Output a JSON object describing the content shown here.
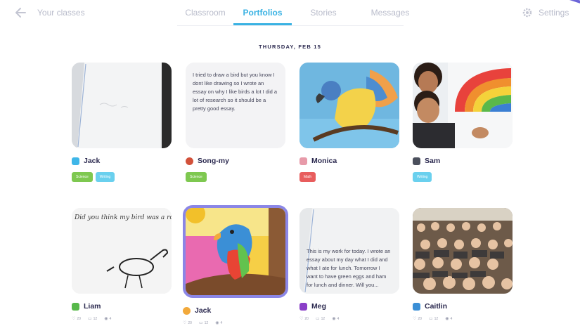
{
  "nav": {
    "back_label": "Your classes",
    "tabs": [
      {
        "label": "Classroom",
        "active": false
      },
      {
        "label": "Portfolios",
        "active": true
      },
      {
        "label": "Stories",
        "active": false
      },
      {
        "label": "Messages",
        "active": false
      }
    ],
    "settings_label": "Settings",
    "accent_color": "#3ab2e3"
  },
  "date_heading": "THURSDAY, FEB 15",
  "posts": [
    {
      "student": "Jack",
      "avatar_color": "#3fb6e8",
      "media": "photo-of-paper",
      "tags": [
        {
          "label": "Science",
          "color": "#7ec850"
        },
        {
          "label": "Writing",
          "color": "#6ad0ee"
        }
      ],
      "selected": false
    },
    {
      "student": "Song-my",
      "avatar_color": "#d2513a",
      "media": "text-note",
      "text": "I tried to draw a bird but you know I dont like drawing so I wrote an essay on why I like birds a lot I did a lot of research so it should be a pretty good essay.",
      "tags": [
        {
          "label": "Science",
          "color": "#7ec850"
        }
      ],
      "selected": false
    },
    {
      "student": "Monica",
      "avatar_color": "#e79aa9",
      "media": "painting-parrot",
      "tags": [
        {
          "label": "Math",
          "color": "#e85d5d"
        }
      ],
      "selected": false
    },
    {
      "student": "Sam",
      "avatar_color": "#4b4f5c",
      "media": "photo-rainbow",
      "tags": [
        {
          "label": "Writing",
          "color": "#6ad0ee"
        }
      ],
      "selected": false
    },
    {
      "student": "Liam",
      "avatar_color": "#57b84a",
      "media": "drawing-bird",
      "handwriting": "Did you think my bird was a robin or parrot?",
      "tags": [],
      "stats": {
        "likes": "20",
        "comments": "12",
        "views": "4"
      },
      "selected": false
    },
    {
      "student": "Jack",
      "avatar_color": "#f2a93b",
      "media": "drawing-parrot",
      "tags": [],
      "stats": {
        "likes": "20",
        "comments": "12",
        "views": "4"
      },
      "selected": true
    },
    {
      "student": "Meg",
      "avatar_color": "#8a3fc8",
      "media": "text-on-paper",
      "text": "This is my work for today. I wrote an essay about my day what I did and what I ate for lunch. Tomorrow I want to have green eggs and ham for lunch and dinner. Will you...",
      "tags": [],
      "stats": {
        "likes": "20",
        "comments": "12",
        "views": "4"
      },
      "selected": false
    },
    {
      "student": "Caitlin",
      "avatar_color": "#3b8fd6",
      "media": "photo-class",
      "tags": [],
      "stats": {
        "likes": "20",
        "comments": "12",
        "views": "4"
      },
      "selected": false
    }
  ]
}
